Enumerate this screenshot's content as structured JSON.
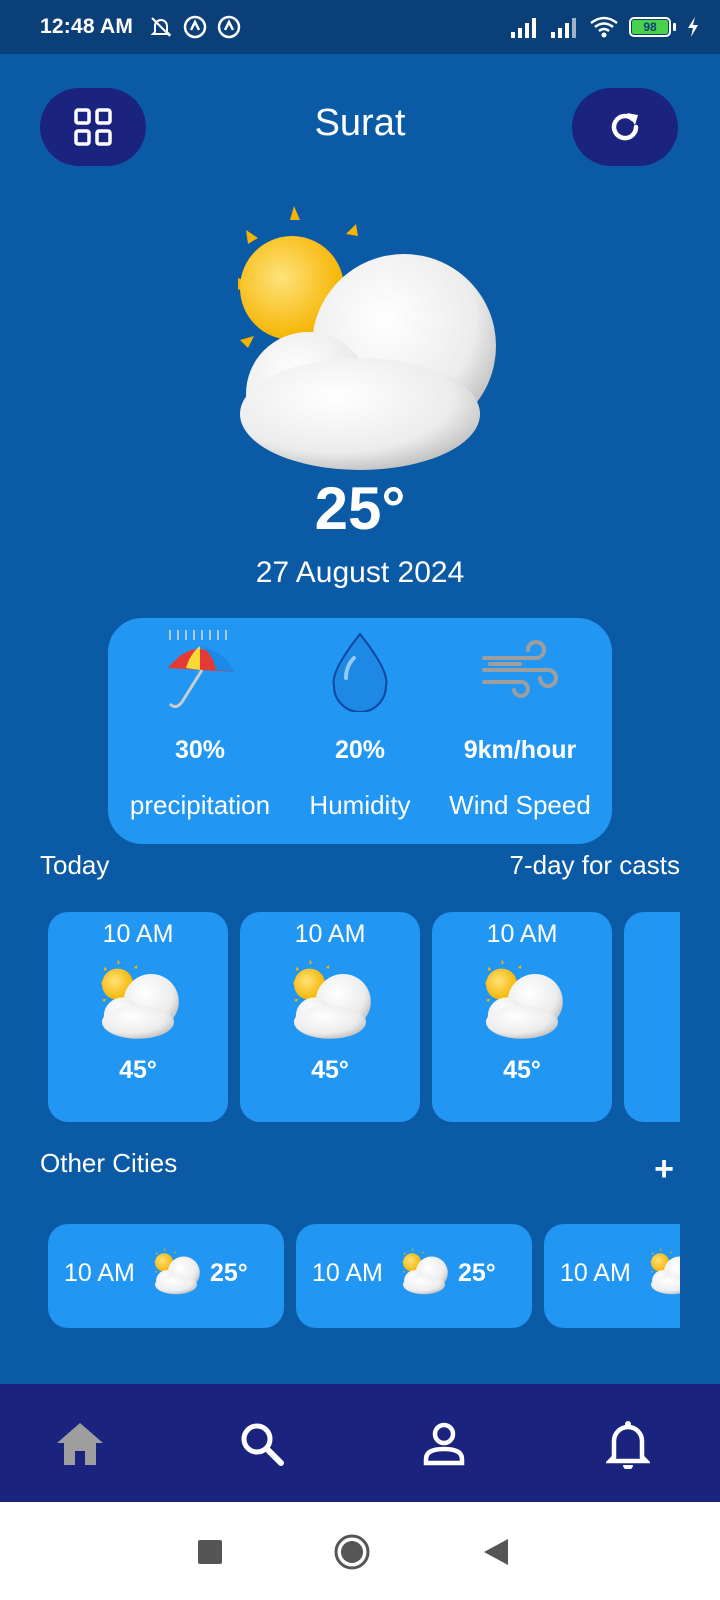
{
  "status_bar": {
    "time": "12:48 AM",
    "battery_level": "98"
  },
  "header": {
    "city": "Surat"
  },
  "current": {
    "temperature": "25°",
    "date": "27 August 2024",
    "icon": "sun-behind-cloud-icon"
  },
  "stats": [
    {
      "value": "30%",
      "label": "precipitation",
      "icon": "umbrella-rain-icon"
    },
    {
      "value": "20%",
      "label": "Humidity",
      "icon": "droplet-icon"
    },
    {
      "value": "9km/hour",
      "label": "Wind Speed",
      "icon": "wind-icon"
    }
  ],
  "sections": {
    "today": "Today",
    "forecast_link": "7-day for casts",
    "other_cities": "Other Cities",
    "add_symbol": "+"
  },
  "hourly": [
    {
      "time": "10 AM",
      "temp": "45°"
    },
    {
      "time": "10 AM",
      "temp": "45°"
    },
    {
      "time": "10 AM",
      "temp": "45°"
    }
  ],
  "cities": [
    {
      "time": "10 AM",
      "temp": "25°"
    },
    {
      "time": "10 AM",
      "temp": "25°"
    },
    {
      "time": "10 AM",
      "temp": ""
    }
  ],
  "bottom_nav": [
    "home-icon",
    "search-icon",
    "profile-icon",
    "bell-icon"
  ],
  "colors": {
    "background": "#0A5AA6",
    "card": "#2196F3",
    "button": "#1A237E",
    "status_bar": "#0B3F78"
  }
}
